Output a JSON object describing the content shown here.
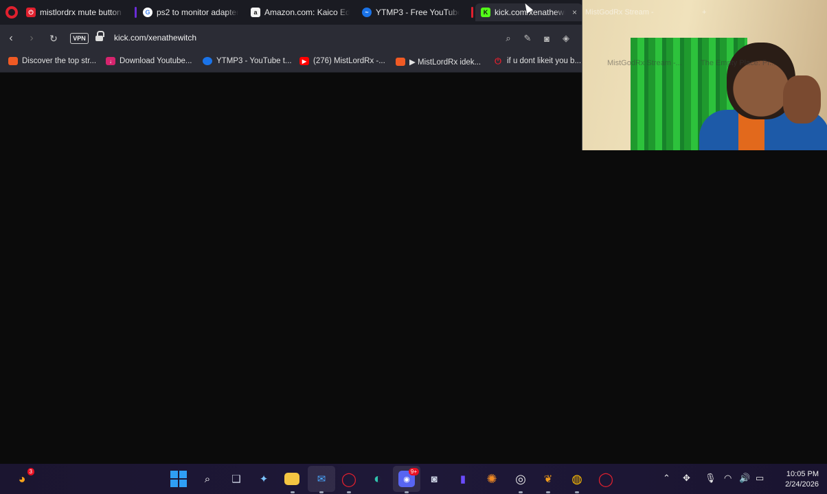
{
  "tabs": [
    {
      "title": "mistlordrx mute button p",
      "favicon_color": "#e0202e",
      "active": false
    },
    {
      "title": "ps2 to monitor adapter -",
      "favicon_color": "#4285f4",
      "active": false
    },
    {
      "title": "Amazon.com: Kaico Editio",
      "favicon_color": "#ffffff",
      "active": false
    },
    {
      "title": "YTMP3 - Free YouTube to",
      "favicon_color": "#1a73e8",
      "active": false
    },
    {
      "title": "kick.com/xenathewitch",
      "favicon_color": "#53fc18",
      "active": true
    },
    {
      "title": "MistGodRx Stream -",
      "favicon_color": "#53fc18",
      "active": false
    }
  ],
  "tab_close_glyph": "×",
  "new_tab_glyph": "+",
  "address": {
    "vpn_label": "VPN",
    "url": "kick.com/xenathewitch"
  },
  "bookmarks": [
    {
      "label": "Discover the top str...",
      "icon": "orange-stream-icon",
      "color": "#f05a24"
    },
    {
      "label": "Download Youtube...",
      "icon": "download-icon",
      "color": "#d6246e"
    },
    {
      "label": "YTMP3 - YouTube t...",
      "icon": "ytmp3-icon",
      "color": "#1a73e8"
    },
    {
      "label": "(276) MistLordRx -...",
      "icon": "youtube-icon",
      "color": "#ff0000"
    },
    {
      "label": "▶ MistLordRx idek...",
      "icon": "orange-stream-icon",
      "color": "#f05a24"
    },
    {
      "label": "if u dont likeit you b...",
      "icon": "power-icon",
      "color": "#e0202e"
    }
  ],
  "overlay_ghost_text": {
    "bookmark_a": "MistGodRx Stream -...",
    "bookmark_b": "The Empty Place: Pr..."
  },
  "taskbar": {
    "notification_count": "3",
    "discord_badge": "9+",
    "time": "10:05 PM",
    "date": "2/24/2026"
  },
  "colors": {
    "tab_bg": "#1a1b22",
    "toolbar_bg": "#2b2c35",
    "page_bg": "#0b0b0b",
    "taskbar_bg": "#1e1838"
  }
}
